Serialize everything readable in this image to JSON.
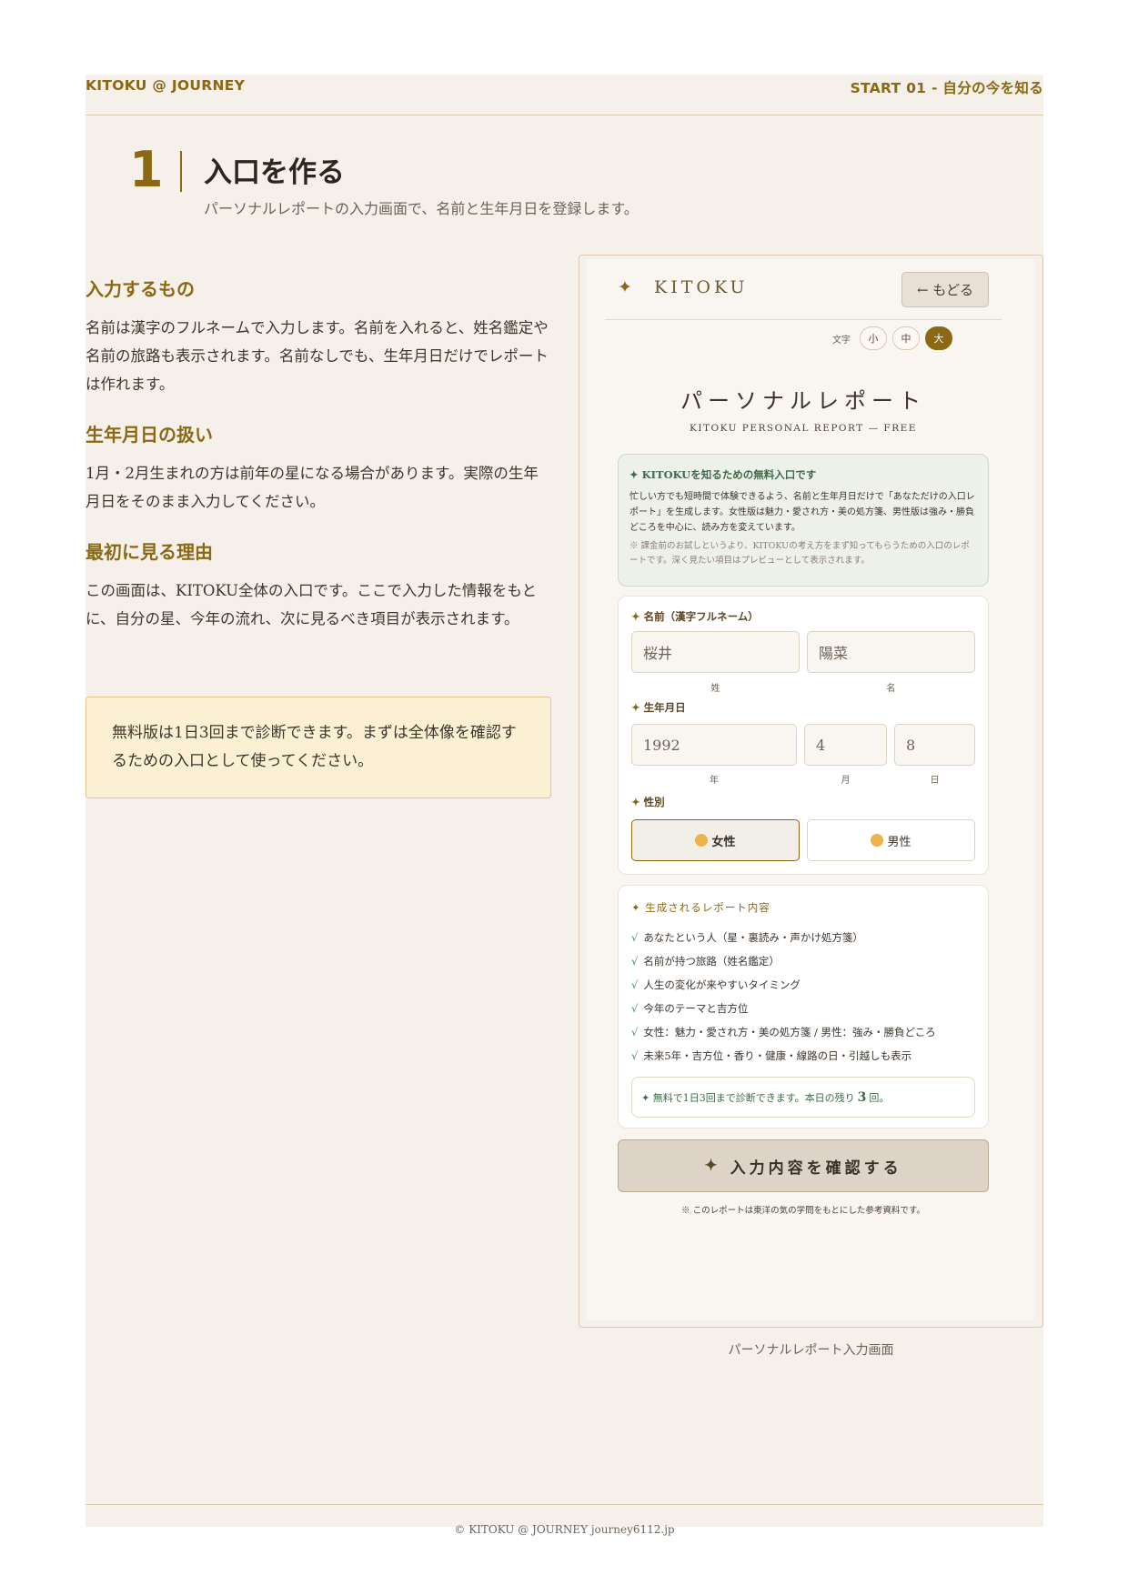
{
  "header": {
    "brand": "KITOKU @ JOURNEY",
    "section": "START 01 - 自分の今を知る"
  },
  "step": {
    "number": "1",
    "title": "入口を作る",
    "subtitle": "パーソナルレポートの入力画面で、名前と生年月日を登録します。"
  },
  "sections": [
    {
      "heading": "入力するもの",
      "body": "名前は漢字のフルネームで入力します。名前を入れると、姓名鑑定や名前の旅路も表示されます。名前なしでも、生年月日だけでレポートは作れます。"
    },
    {
      "heading": "生年月日の扱い",
      "body": "1月・2月生まれの方は前年の星になる場合があります。実際の生年月日をそのまま入力してください。"
    },
    {
      "heading": "最初に見る理由",
      "body": "この画面は、KITOKU全体の入口です。ここで入力した情報をもとに、自分の星、今年の流れ、次に見るべき項目が表示されます。"
    }
  ],
  "note": "無料版は1日3回まで診断できます。まずは全体像を確認するための入口として使ってください。",
  "screenshot": {
    "logo_star": "✦",
    "logo_text": "KITOKU",
    "back_button": "← もどる",
    "font_size_label": "文字",
    "font_sizes": [
      "小",
      "中",
      "大"
    ],
    "title": "パーソナルレポート",
    "subtitle": "KITOKU PERSONAL REPORT — FREE",
    "intro_heading": "✦ KITOKUを知るための無料入口です",
    "intro_body": "忙しい方でも短時間で体験できるよう、名前と生年月日だけで「あなただけの入口レポート」を生成します。女性版は魅力・愛され方・美の処方箋、男性版は強み・勝負どころを中心に、読み方を変えています。",
    "intro_note": "※ 課金前のお試しというより、KITOKUの考え方をまず知ってもらうための入口のレポートです。深く見たい項目はプレビューとして表示されます。",
    "name_label": "名前（漢字フルネーム）",
    "surname_value": "桜井",
    "given_value": "陽菜",
    "surname_hint": "姓",
    "given_hint": "名",
    "birth_label": "生年月日",
    "year_value": "1992",
    "month_value": "4",
    "day_value": "8",
    "year_hint": "年",
    "month_hint": "月",
    "day_hint": "日",
    "gender_label": "性別",
    "female": "女性",
    "male": "男性",
    "contents_heading": "✦ 生成されるレポート内容",
    "contents": [
      "あなたという人（星・裏読み・声かけ処方箋）",
      "名前が持つ旅路（姓名鑑定）",
      "人生の変化が来やすいタイミング",
      "今年のテーマと吉方位",
      "女性：魅力・愛され方・美の処方箋 / 男性：強み・勝負どころ",
      "未来5年・吉方位・香り・健康・線路の日・引越しも表示"
    ],
    "free_pre": "✦ 無料で1日3回まで診断できます。本日の残り",
    "free_count": "3",
    "free_post": "回。",
    "confirm_star": "✦",
    "confirm_label": "入力内容を確認する",
    "disclaimer": "※ このレポートは東洋の気の学問をもとにした参考資料です。"
  },
  "caption": "パーソナルレポート入力画面",
  "footer": "© KITOKU @ JOURNEY journey6112.jp"
}
